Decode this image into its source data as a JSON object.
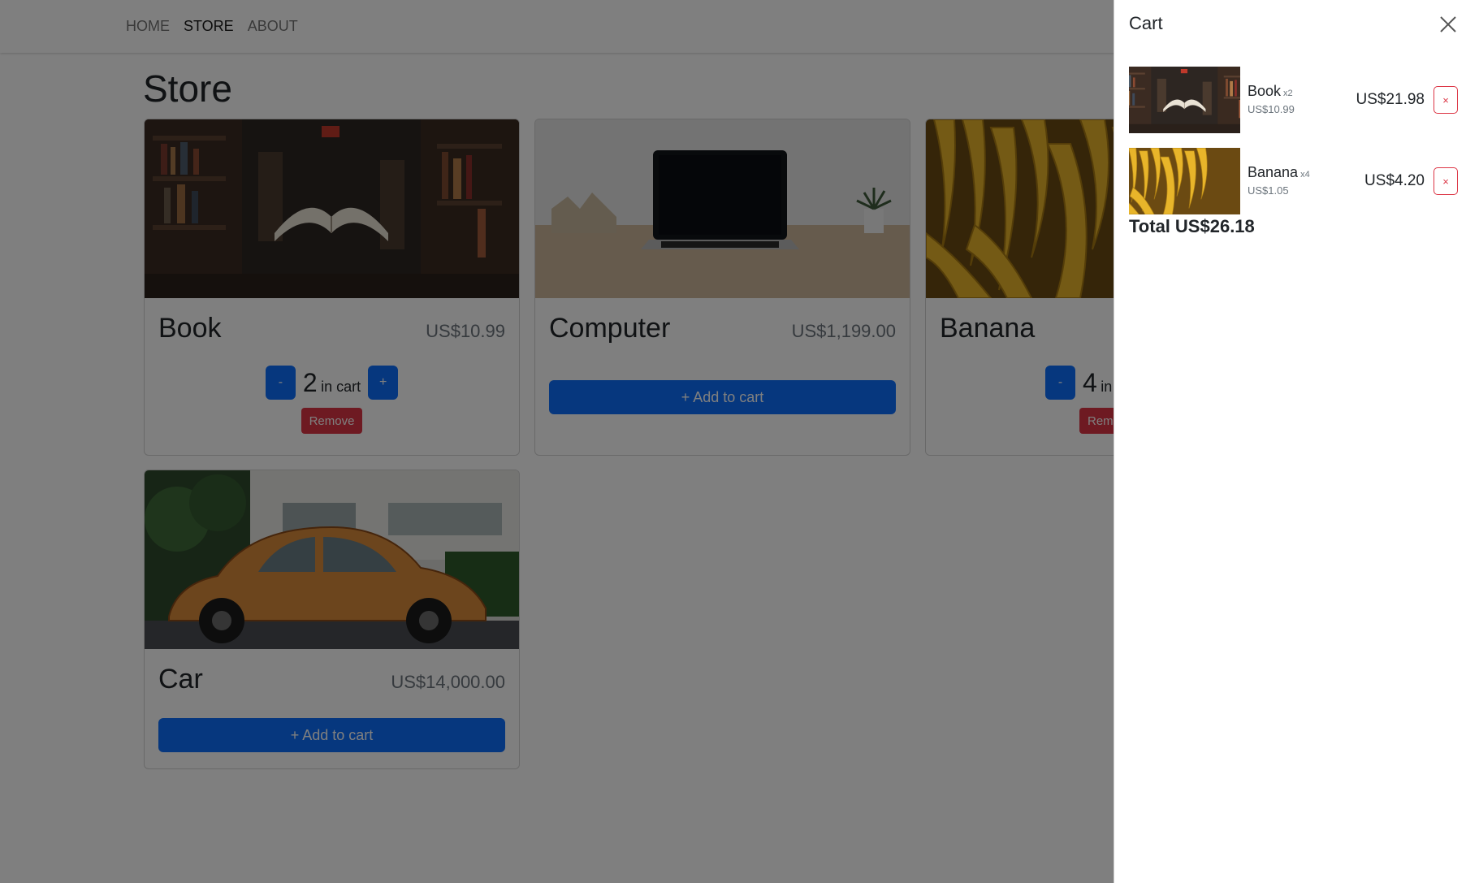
{
  "nav": {
    "links": [
      {
        "label": "HOME",
        "active": false
      },
      {
        "label": "STORE",
        "active": true
      },
      {
        "label": "ABOUT",
        "active": false
      }
    ],
    "cart_icon": "cart-icon"
  },
  "page": {
    "title": "Store"
  },
  "products": [
    {
      "name": "Book",
      "price": "US$10.99",
      "in_cart": "2",
      "in_cart_suffix": "in cart",
      "minus_label": "-",
      "plus_label": "+",
      "remove_label": "Remove",
      "image": "floating-book-in-library"
    },
    {
      "name": "Computer",
      "price": "US$1,199.00",
      "add_label": "+ Add to cart",
      "image": "laptop-on-desk"
    },
    {
      "name": "Banana",
      "price": "",
      "in_cart": "4",
      "in_cart_suffix": "in",
      "minus_label": "-",
      "remove_label": "Rem",
      "image": "banana-bunches"
    },
    {
      "name": "Car",
      "price": "US$14,000.00",
      "add_label": "+ Add to cart",
      "image": "orange-beetle-car"
    }
  ],
  "cart": {
    "title": "Cart",
    "close_icon": "close-icon",
    "items": [
      {
        "name": "Book",
        "qty": "x2",
        "unit_price": "US$10.99",
        "total": "US$21.98",
        "remove_label": "×",
        "image": "floating-book-in-library"
      },
      {
        "name": "Banana",
        "qty": "x4",
        "unit_price": "US$1.05",
        "total": "US$4.20",
        "remove_label": "×",
        "image": "banana-bunches"
      }
    ],
    "total_label": "Total",
    "total_value": "US$26.18"
  },
  "colors": {
    "primary": "#0d6efd",
    "danger": "#dc3545",
    "backdrop": "rgba(0,0,0,0.5)",
    "muted": "#6c757d"
  }
}
